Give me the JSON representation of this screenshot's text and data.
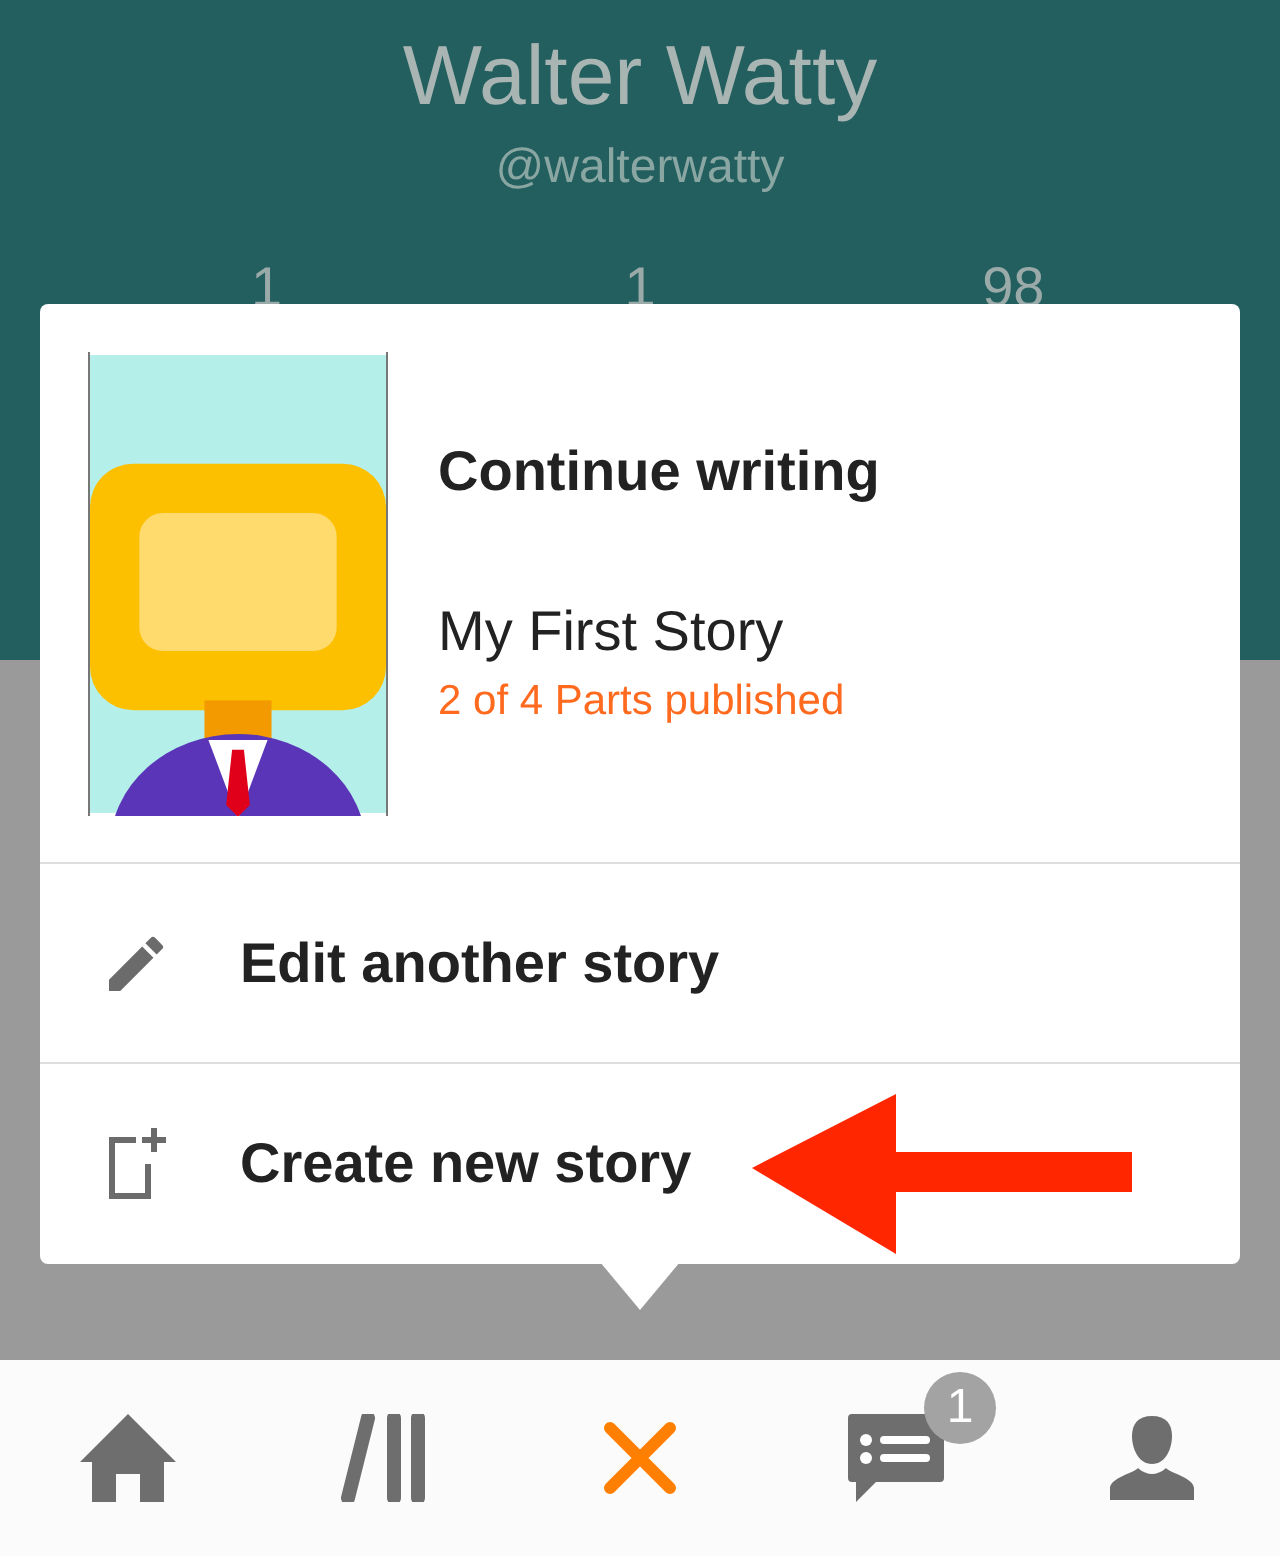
{
  "profile": {
    "name": "Walter Watty",
    "handle": "@walterwatty",
    "stats": [
      "1",
      "1",
      "98"
    ]
  },
  "popup": {
    "heading": "Continue writing",
    "story_title": "My First Story",
    "progress": "2 of 4 Parts published",
    "actions": [
      {
        "kind": "edit",
        "label": "Edit another story",
        "annotated": false
      },
      {
        "kind": "create",
        "label": "Create new story",
        "annotated": true
      }
    ]
  },
  "nav": [
    {
      "kind": "home",
      "selected": false
    },
    {
      "kind": "library",
      "selected": false
    },
    {
      "kind": "write",
      "selected": true
    },
    {
      "kind": "messages",
      "selected": false,
      "badge": "1"
    },
    {
      "kind": "profile",
      "selected": false
    }
  ]
}
